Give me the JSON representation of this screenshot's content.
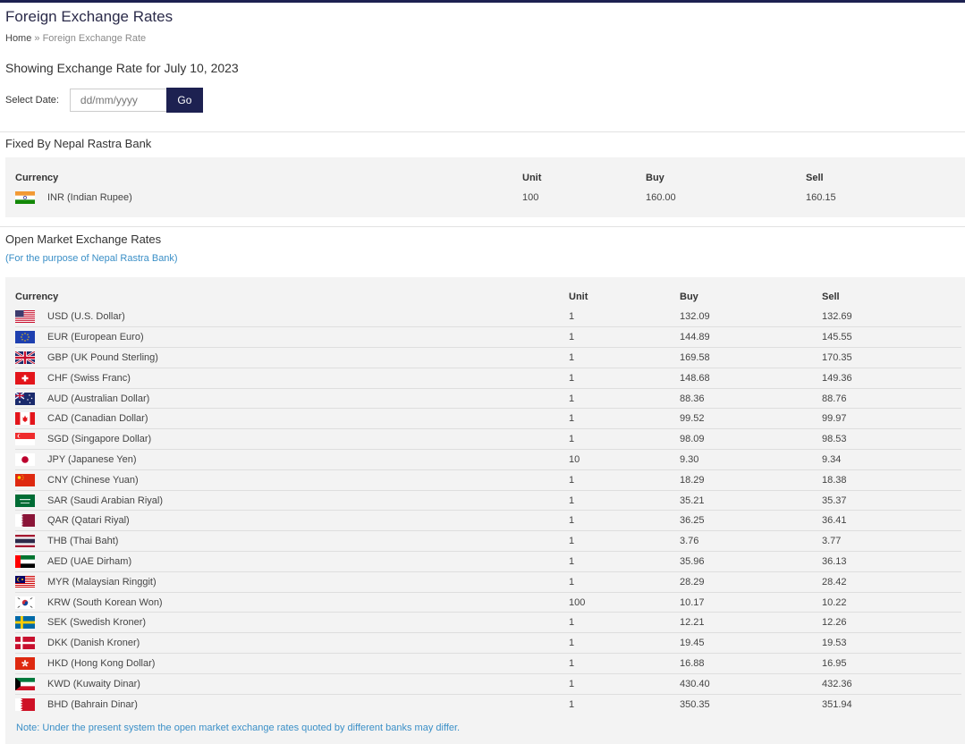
{
  "page": {
    "title": "Foreign Exchange Rates",
    "breadcrumb_home": "Home",
    "breadcrumb_sep": " » ",
    "breadcrumb_current": "Foreign Exchange Rate",
    "showing": "Showing Exchange Rate for July 10, 2023"
  },
  "date_picker": {
    "label": "Select Date:",
    "placeholder": "dd/mm/yyyy",
    "go_label": "Go"
  },
  "fixed": {
    "title": "Fixed By Nepal Rastra Bank",
    "headers": {
      "currency": "Currency",
      "unit": "Unit",
      "buy": "Buy",
      "sell": "Sell"
    },
    "rows": [
      {
        "flag": "in",
        "currency": "INR (Indian Rupee)",
        "unit": "100",
        "buy": "160.00",
        "sell": "160.15"
      }
    ]
  },
  "open_market": {
    "title": "Open Market Exchange Rates",
    "subtitle": "(For the purpose of Nepal Rastra Bank)",
    "headers": {
      "currency": "Currency",
      "unit": "Unit",
      "buy": "Buy",
      "sell": "Sell"
    },
    "rows": [
      {
        "flag": "us",
        "currency": "USD (U.S. Dollar)",
        "unit": "1",
        "buy": "132.09",
        "sell": "132.69"
      },
      {
        "flag": "eu",
        "currency": "EUR (European Euro)",
        "unit": "1",
        "buy": "144.89",
        "sell": "145.55"
      },
      {
        "flag": "gb",
        "currency": "GBP (UK Pound Sterling)",
        "unit": "1",
        "buy": "169.58",
        "sell": "170.35"
      },
      {
        "flag": "ch",
        "currency": "CHF (Swiss Franc)",
        "unit": "1",
        "buy": "148.68",
        "sell": "149.36"
      },
      {
        "flag": "au",
        "currency": "AUD (Australian Dollar)",
        "unit": "1",
        "buy": "88.36",
        "sell": "88.76"
      },
      {
        "flag": "ca",
        "currency": "CAD (Canadian Dollar)",
        "unit": "1",
        "buy": "99.52",
        "sell": "99.97"
      },
      {
        "flag": "sg",
        "currency": "SGD (Singapore Dollar)",
        "unit": "1",
        "buy": "98.09",
        "sell": "98.53"
      },
      {
        "flag": "jp",
        "currency": "JPY (Japanese Yen)",
        "unit": "10",
        "buy": "9.30",
        "sell": "9.34"
      },
      {
        "flag": "cn",
        "currency": "CNY (Chinese Yuan)",
        "unit": "1",
        "buy": "18.29",
        "sell": "18.38"
      },
      {
        "flag": "sa",
        "currency": "SAR (Saudi Arabian Riyal)",
        "unit": "1",
        "buy": "35.21",
        "sell": "35.37"
      },
      {
        "flag": "qa",
        "currency": "QAR (Qatari Riyal)",
        "unit": "1",
        "buy": "36.25",
        "sell": "36.41"
      },
      {
        "flag": "th",
        "currency": "THB (Thai Baht)",
        "unit": "1",
        "buy": "3.76",
        "sell": "3.77"
      },
      {
        "flag": "ae",
        "currency": "AED (UAE Dirham)",
        "unit": "1",
        "buy": "35.96",
        "sell": "36.13"
      },
      {
        "flag": "my",
        "currency": "MYR (Malaysian Ringgit)",
        "unit": "1",
        "buy": "28.29",
        "sell": "28.42"
      },
      {
        "flag": "kr",
        "currency": "KRW (South Korean Won)",
        "unit": "100",
        "buy": "10.17",
        "sell": "10.22"
      },
      {
        "flag": "se",
        "currency": "SEK (Swedish Kroner)",
        "unit": "1",
        "buy": "12.21",
        "sell": "12.26"
      },
      {
        "flag": "dk",
        "currency": "DKK (Danish Kroner)",
        "unit": "1",
        "buy": "19.45",
        "sell": "19.53"
      },
      {
        "flag": "hk",
        "currency": "HKD (Hong Kong Dollar)",
        "unit": "1",
        "buy": "16.88",
        "sell": "16.95"
      },
      {
        "flag": "kw",
        "currency": "KWD (Kuwaity Dinar)",
        "unit": "1",
        "buy": "430.40",
        "sell": "432.36"
      },
      {
        "flag": "bh",
        "currency": "BHD (Bahrain Dinar)",
        "unit": "1",
        "buy": "350.35",
        "sell": "351.94"
      }
    ],
    "note": "Note: Under the present system the open market exchange rates quoted by different banks may differ."
  },
  "colors": {
    "brand_navy": "#1d2151",
    "link_blue": "#3a8fc7",
    "panel_bg": "#f3f3f3"
  }
}
